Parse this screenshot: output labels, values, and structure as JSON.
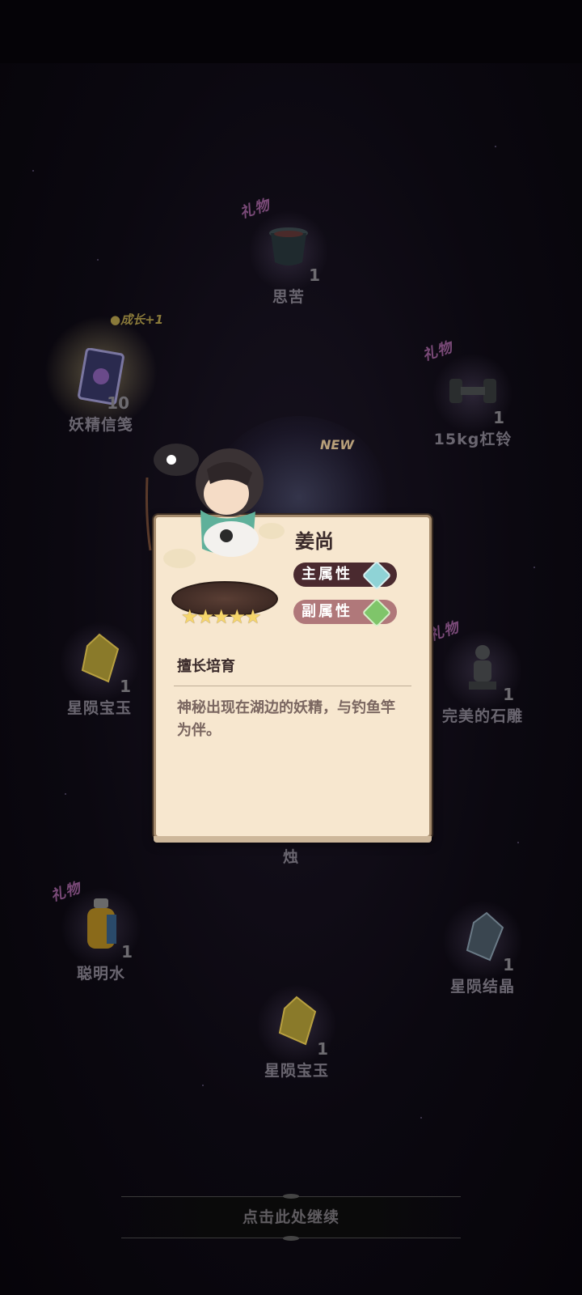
{
  "rewards": [
    {
      "name": "思苦",
      "count": "1",
      "icon": "cauldron-icon",
      "gift_tag": "礼物"
    },
    {
      "name": "妖精信笺",
      "count": "10",
      "icon": "letter-card-icon",
      "badge": "●成长+1"
    },
    {
      "name": "15kg杠铃",
      "count": "1",
      "icon": "dumbbell-icon",
      "gift_tag": "礼物"
    },
    {
      "name": "星陨宝玉",
      "count": "1",
      "icon": "gold-gem-icon"
    },
    {
      "name": "完美的石雕",
      "count": "1",
      "icon": "stone-statue-icon",
      "gift_tag": "礼物"
    },
    {
      "name": "烛",
      "icon": "candle-icon"
    },
    {
      "name": "聪明水",
      "count": "1",
      "icon": "potion-bottle-icon",
      "gift_tag": "礼物"
    },
    {
      "name": "星陨结晶",
      "count": "1",
      "icon": "crystal-icon"
    },
    {
      "name": "星陨宝玉",
      "count": "1",
      "icon": "gold-gem-icon"
    }
  ],
  "new_badge": "NEW",
  "card": {
    "name": "姜尚",
    "main_attr": "主属性",
    "sub_attr": "副属性",
    "stars": 5,
    "skill": "擅长培育",
    "description": "神秘出现在湖边的妖精，与钓鱼竿为伴。"
  },
  "continue_text": "点击此处继续",
  "colors": {
    "card_bg": "#f7e7cf",
    "main_attr": "#4a2a2f",
    "sub_attr": "#b0787a",
    "gem_main": "#8fd3d6",
    "gem_sub": "#7fc56a"
  }
}
